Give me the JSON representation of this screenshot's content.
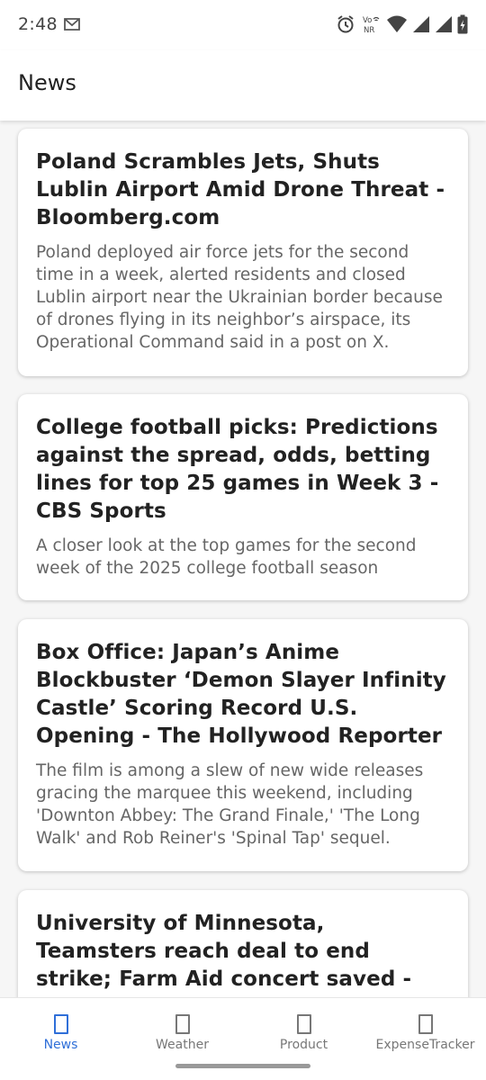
{
  "status_bar": {
    "time": "2:48",
    "icons": [
      "mail-icon",
      "alarm-icon",
      "volte-icon",
      "wifi-icon",
      "signal-icon",
      "signal-icon",
      "battery-icon"
    ],
    "volte_label": "Vo",
    "nr_label": "NR"
  },
  "app_bar": {
    "title": "News"
  },
  "articles": [
    {
      "title": "Poland Scrambles Jets, Shuts Lublin Airport Amid Drone Threat - Bloomberg.com",
      "description": "Poland deployed air force jets for the second time in a week, alerted residents and closed Lublin airport near the Ukrainian border because of drones flying in its neighbor’s airspace, its Operational Command said in a post on X."
    },
    {
      "title": "College football picks: Predictions against the spread, odds, betting lines for top 25 games in Week 3 - CBS Sports",
      "description": "A closer look at the top games for the second week of the 2025 college football season"
    },
    {
      "title": "Box Office: Japan’s Anime Blockbuster ‘Demon Slayer Infinity Castle’ Scoring Record U.S. Opening - The Hollywood Reporter",
      "description": "The film is among a slew of new wide releases gracing the marquee this weekend, including 'Downton Abbey: The Grand Finale,' 'The Long Walk' and Rob Reiner's 'Spinal Tap' sequel."
    },
    {
      "title": "University of Minnesota, Teamsters reach deal to end strike; Farm Aid concert saved - Star Tribune",
      "description": ""
    }
  ],
  "bottom_nav": {
    "active_color": "#2f6fd8",
    "items": [
      {
        "label": "News",
        "active": true
      },
      {
        "label": "Weather",
        "active": false
      },
      {
        "label": "Product",
        "active": false
      },
      {
        "label": "ExpenseTracker",
        "active": false
      }
    ]
  }
}
